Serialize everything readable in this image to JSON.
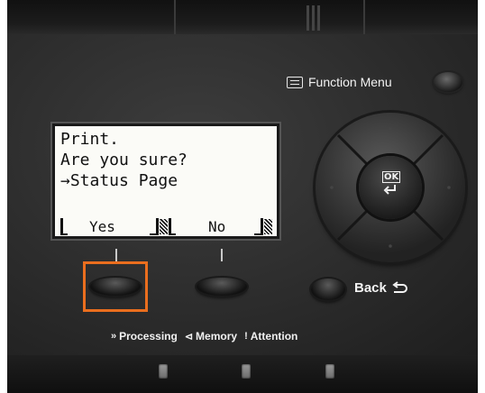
{
  "function_menu": {
    "label": "Function Menu",
    "icon": "menu-list-icon"
  },
  "lcd": {
    "line1": "Print.",
    "line2": "Are you sure?",
    "line3": "→Status Page",
    "softkey_left": "Yes",
    "softkey_right": "No"
  },
  "ok_button": {
    "label": "OK",
    "icon": "enter-icon"
  },
  "back": {
    "label": "Back",
    "icon": "back-arrow-icon"
  },
  "status": {
    "processing": {
      "label": "Processing",
      "glyph": "»"
    },
    "memory": {
      "label": "Memory",
      "glyph": "⊲"
    },
    "attention": {
      "label": "Attention",
      "glyph": "!"
    }
  },
  "colors": {
    "highlight": "#ea6e1e",
    "panel": "#2c2c2c",
    "lcd": "#fbfbf7"
  }
}
